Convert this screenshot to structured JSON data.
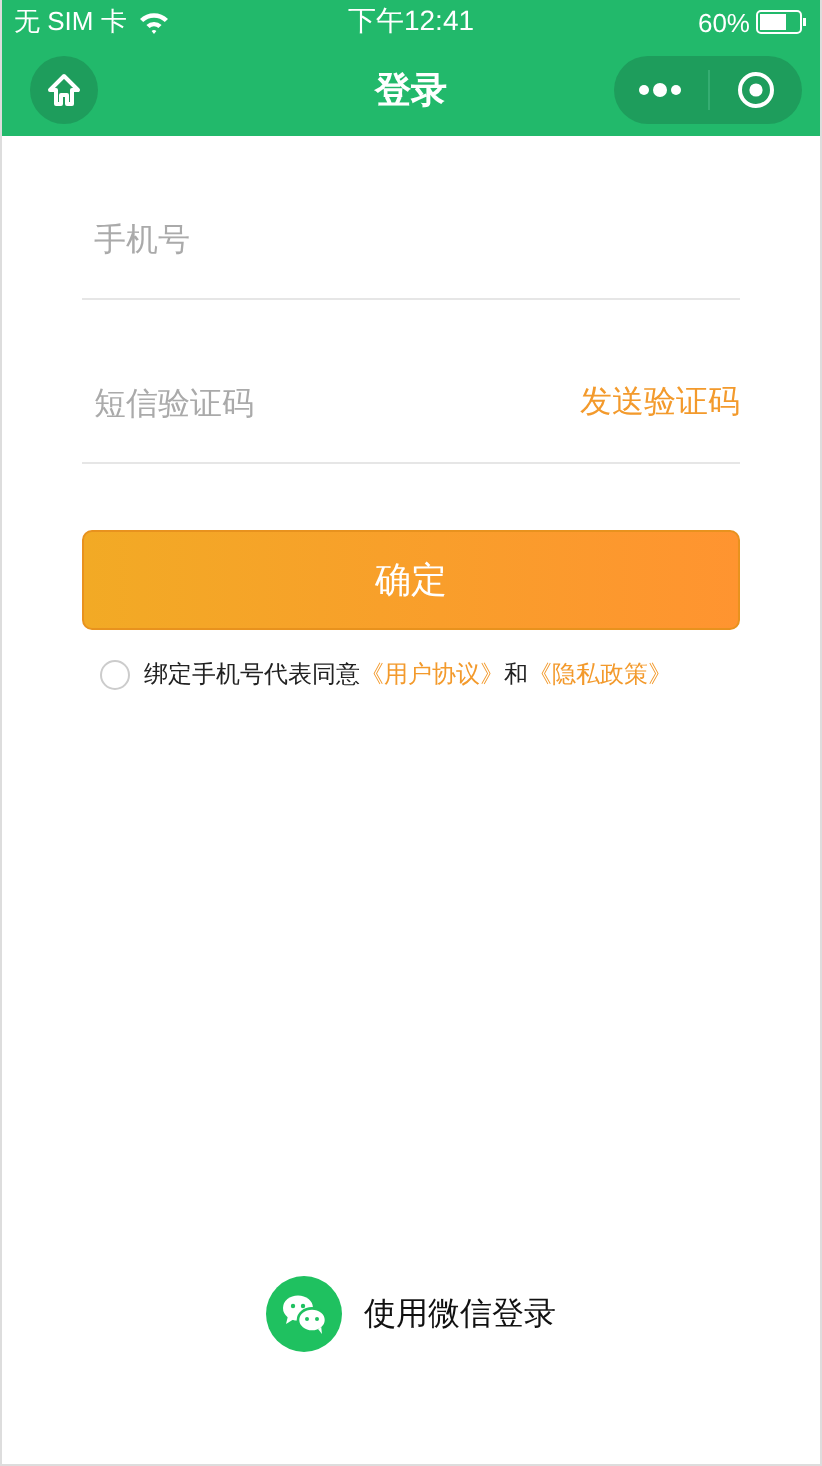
{
  "status_bar": {
    "carrier": "无 SIM 卡",
    "time": "下午12:41",
    "battery": "60%"
  },
  "nav": {
    "title": "登录"
  },
  "phone_field": {
    "placeholder": "手机号"
  },
  "code_field": {
    "placeholder": "短信验证码",
    "send_link": "发送验证码"
  },
  "confirm_button": "确定",
  "agreement": {
    "checked": false,
    "text": "绑定手机号代表同意",
    "link_1": "《用户协议》",
    "joiner": "和",
    "link_2": "《隐私政策》"
  },
  "wechat_login": "使用微信登录"
}
